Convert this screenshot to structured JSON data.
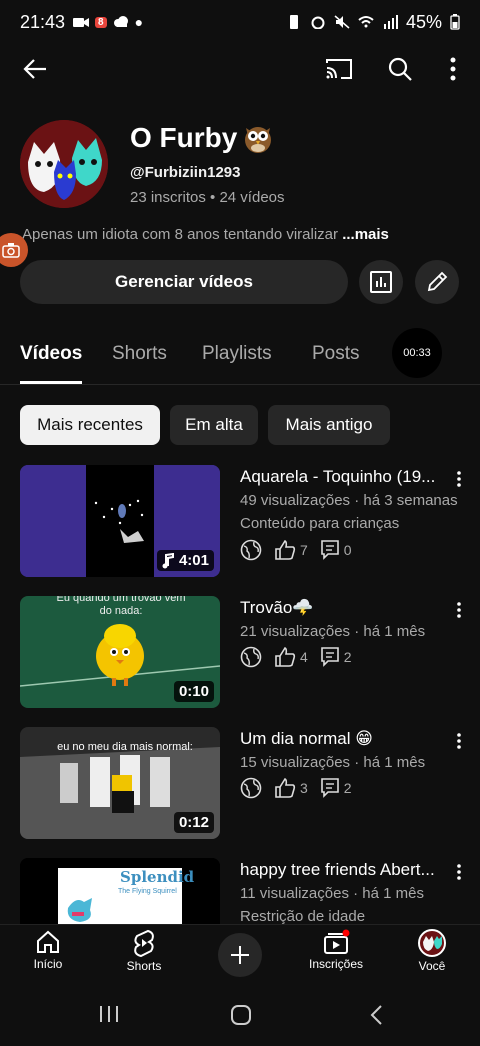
{
  "status_bar": {
    "time": "21:43",
    "notif_badge": "8",
    "battery": "45%"
  },
  "app_bar": {
    "icons": [
      "back-arrow-icon",
      "cast-icon",
      "search-icon",
      "more-vert-icon"
    ]
  },
  "channel": {
    "title": "O Furby",
    "handle": "@Furbiziin1293",
    "stats": "23 inscritos • 24 vídeos",
    "description": "Apenas um idiota com 8 anos tentando viralizar",
    "more_label": "...mais",
    "manage_label": "Gerenciar vídeos"
  },
  "tabs": [
    {
      "label": "Vídeos",
      "active": true
    },
    {
      "label": "Shorts",
      "active": false
    },
    {
      "label": "Playlists",
      "active": false
    },
    {
      "label": "Posts",
      "active": false
    }
  ],
  "timer_label": "00:33",
  "chips": [
    {
      "label": "Mais recentes",
      "selected": true
    },
    {
      "label": "Em alta",
      "selected": false
    },
    {
      "label": "Mais antigo",
      "selected": false
    }
  ],
  "videos": [
    {
      "title": "Aquarela - Toquinho (19...",
      "meta": "49 visualizações · há 3 semanas",
      "extra": "Conteúdo para crianças",
      "duration": "4:01",
      "likes": "7",
      "comments": "0"
    },
    {
      "title": "Trovão🌩️",
      "meta": "21 visualizações · há 1 mês",
      "extra": "",
      "duration": "0:10",
      "likes": "4",
      "comments": "2",
      "thumb_text": "Eu quando um trovão vem do nada:"
    },
    {
      "title": "Um dia normal 😁",
      "meta": "15 visualizações · há 1 mês",
      "extra": "",
      "duration": "0:12",
      "likes": "3",
      "comments": "2",
      "thumb_text": "eu no meu dia mais normal:"
    },
    {
      "title": "happy tree friends Abert...",
      "meta": "11 visualizações · há 1 mês",
      "extra": "Restrição de idade",
      "duration": "",
      "likes": "",
      "comments": "",
      "thumb_text": "Splendid",
      "thumb_sub": "The Flying Squirrel"
    }
  ],
  "bottom_nav": [
    {
      "label": "Início",
      "icon": "home-icon"
    },
    {
      "label": "Shorts",
      "icon": "shorts-icon"
    },
    {
      "label": "",
      "icon": "create-plus-icon"
    },
    {
      "label": "Inscrições",
      "icon": "subscriptions-icon"
    },
    {
      "label": "Você",
      "icon": "you-avatar-icon"
    }
  ],
  "colors": {
    "background": "#0f0f0f",
    "surface": "#272727",
    "text": "#ffffff",
    "muted": "#aaaaaa",
    "accent": "#ff0000"
  }
}
